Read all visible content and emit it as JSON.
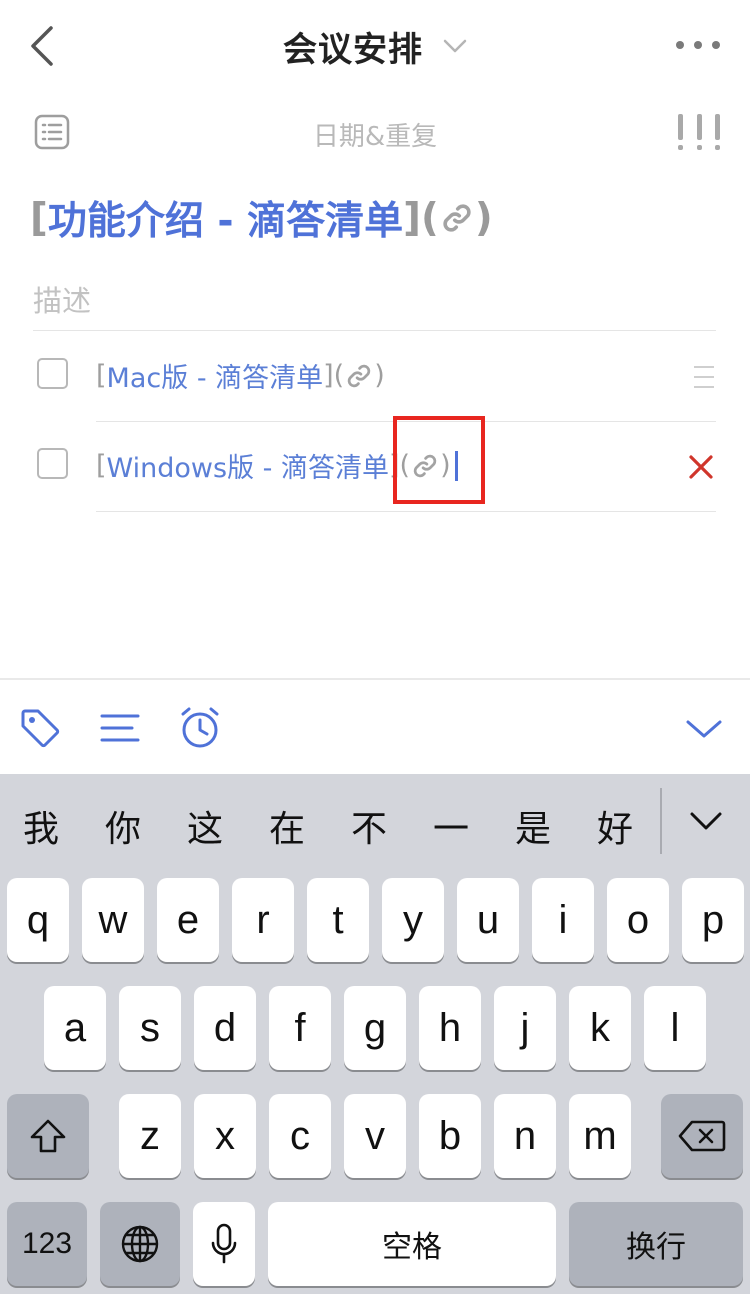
{
  "header": {
    "title": "会议安排"
  },
  "date_row": {
    "label": "日期&重复"
  },
  "task": {
    "title_open": "[",
    "title_text": "功能介绍 - 滴答清单",
    "title_close": "](",
    "title_end": ")",
    "description_placeholder": "描述"
  },
  "checklist": [
    {
      "open": "[",
      "text": "Mac版 - 滴答清单",
      "close": "](",
      "end": ")"
    },
    {
      "open": "[",
      "text": "Windows版 - 滴答清单",
      "close": "](",
      "end": ")"
    }
  ],
  "keyboard": {
    "candidates": [
      "我",
      "你",
      "这",
      "在",
      "不",
      "一",
      "是",
      "好"
    ],
    "row1": [
      "q",
      "w",
      "e",
      "r",
      "t",
      "y",
      "u",
      "i",
      "o",
      "p"
    ],
    "row2": [
      "a",
      "s",
      "d",
      "f",
      "g",
      "h",
      "j",
      "k",
      "l"
    ],
    "row3": [
      "z",
      "x",
      "c",
      "v",
      "b",
      "n",
      "m"
    ],
    "num_label": "123",
    "space_label": "空格",
    "return_label": "换行"
  },
  "colors": {
    "link": "#4f72d8",
    "delete": "#d0352b",
    "highlight": "#e8261f",
    "keyboard_bg": "#d3d5db"
  }
}
